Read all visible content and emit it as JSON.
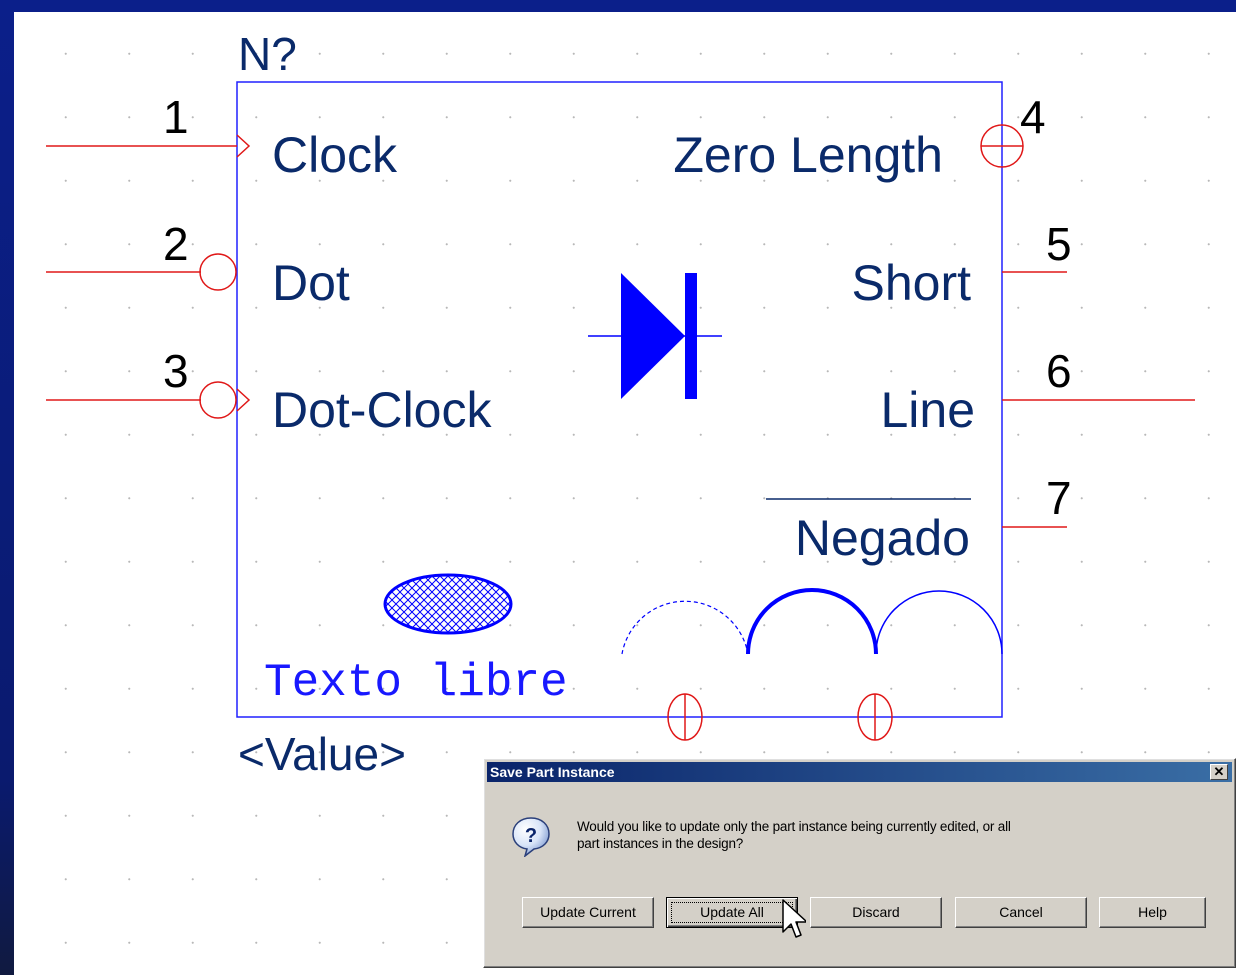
{
  "schematic": {
    "reference": "N?",
    "value": "<Value>",
    "free_text": "Texto libre",
    "pins": [
      {
        "number": "1",
        "name": "Clock"
      },
      {
        "number": "2",
        "name": "Dot"
      },
      {
        "number": "3",
        "name": "Dot-Clock"
      },
      {
        "number": "4",
        "name": "Zero Length"
      },
      {
        "number": "5",
        "name": "Short"
      },
      {
        "number": "6",
        "name": "Line"
      },
      {
        "number": "7",
        "name": "Negado"
      }
    ],
    "colors": {
      "outline": "#2020ff",
      "text": "#0a2a6a",
      "pin": "#e01818",
      "drawing": "#0000ff"
    }
  },
  "dialog": {
    "title": "Save Part Instance",
    "close_label": "✕",
    "icon": "question-icon",
    "message_line1": "Would you like to update only the part instance being currently edited, or all",
    "message_line2": "part instances in the design?",
    "buttons": {
      "update_current": "Update Current",
      "update_all": "Update All",
      "discard": "Discard",
      "cancel": "Cancel",
      "help": "Help"
    },
    "focused_button": "Update All"
  }
}
